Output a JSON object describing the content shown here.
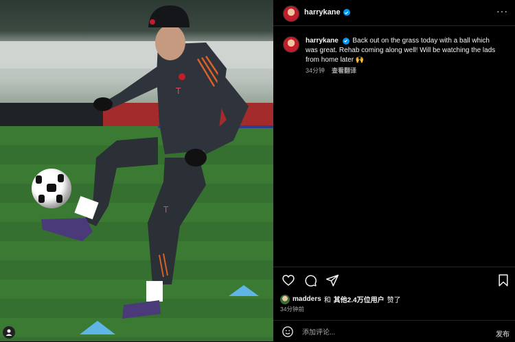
{
  "post": {
    "username": "harrykane",
    "caption": "Back out on the grass today with a ball which was great. Rehab coming along well! Will be watching the lads from home later 🙌",
    "caption_time": "34分钟",
    "translate_label": "查看翻译",
    "likes_user": "madders",
    "likes_joiner": "和",
    "likes_others": "其他2.4万位用户",
    "likes_suffix": "赞了",
    "post_time": "34分钟前"
  },
  "comment": {
    "placeholder": "添加评论...",
    "post_label": "发布"
  },
  "header": {
    "more_label": "···"
  },
  "icons": {
    "like": "heart-icon",
    "comment": "comment-icon",
    "share": "share-icon",
    "save": "bookmark-icon",
    "emoji": "emoji-icon",
    "verified": "verified-badge-icon",
    "more": "more-options-icon",
    "profile": "user-profile-icon"
  },
  "colors": {
    "background": "#000000",
    "verified": "#0095f6",
    "secondary_text": "#a8a8a8"
  }
}
